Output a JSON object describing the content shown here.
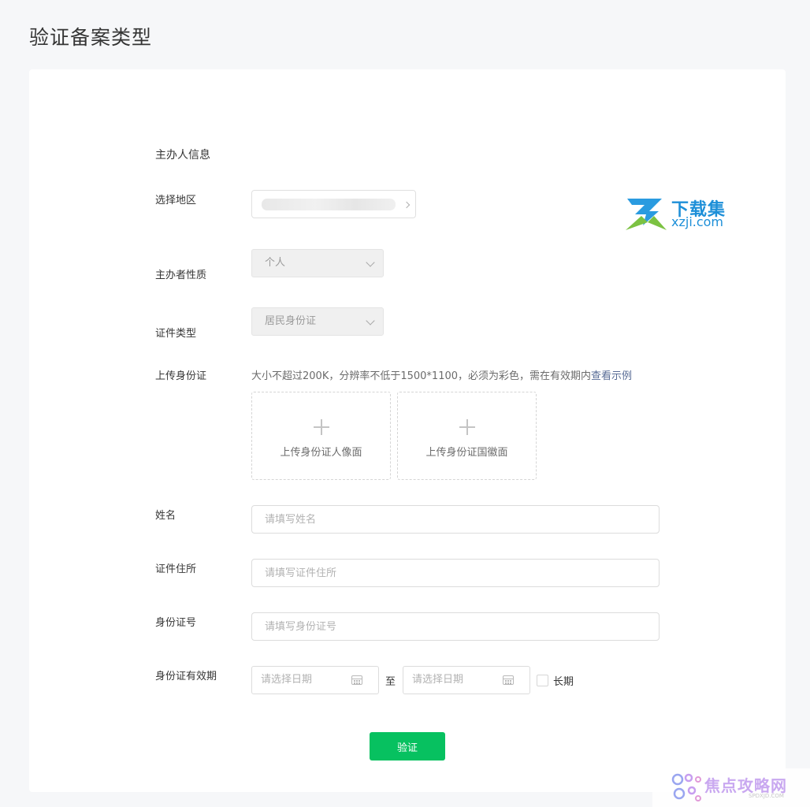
{
  "page": {
    "title": "验证备案类型"
  },
  "form": {
    "section_title": "主办人信息",
    "region": {
      "label": "选择地区"
    },
    "host_nature": {
      "label": "主办者性质",
      "value": "个人"
    },
    "id_type": {
      "label": "证件类型",
      "value": "居民身份证"
    },
    "upload": {
      "label": "上传身份证",
      "hint": "大小不超过200K，分辨率不低于1500*1100，必须为彩色，需在有效期内",
      "hint_link": "查看示例",
      "front_label": "上传身份证人像面",
      "back_label": "上传身份证国徽面"
    },
    "name": {
      "label": "姓名",
      "placeholder": "请填写姓名"
    },
    "address": {
      "label": "证件住所",
      "placeholder": "请填写证件住所"
    },
    "id_number": {
      "label": "身份证号",
      "placeholder": "请填写身份证号"
    },
    "validity": {
      "label": "身份证有效期",
      "start_placeholder": "请选择日期",
      "separator": "至",
      "end_placeholder": "请选择日期",
      "long_term_label": "长期"
    },
    "submit_label": "验证"
  },
  "watermarks": {
    "top": {
      "line1": "下载集",
      "line2": "xzji.com"
    },
    "bottom": {
      "text": "焦点攻略网",
      "sub": "SPDXJD.COM"
    }
  },
  "colors": {
    "primary": "#07c160",
    "link": "#576b95",
    "background": "#f6f7f9",
    "card": "#ffffff"
  }
}
